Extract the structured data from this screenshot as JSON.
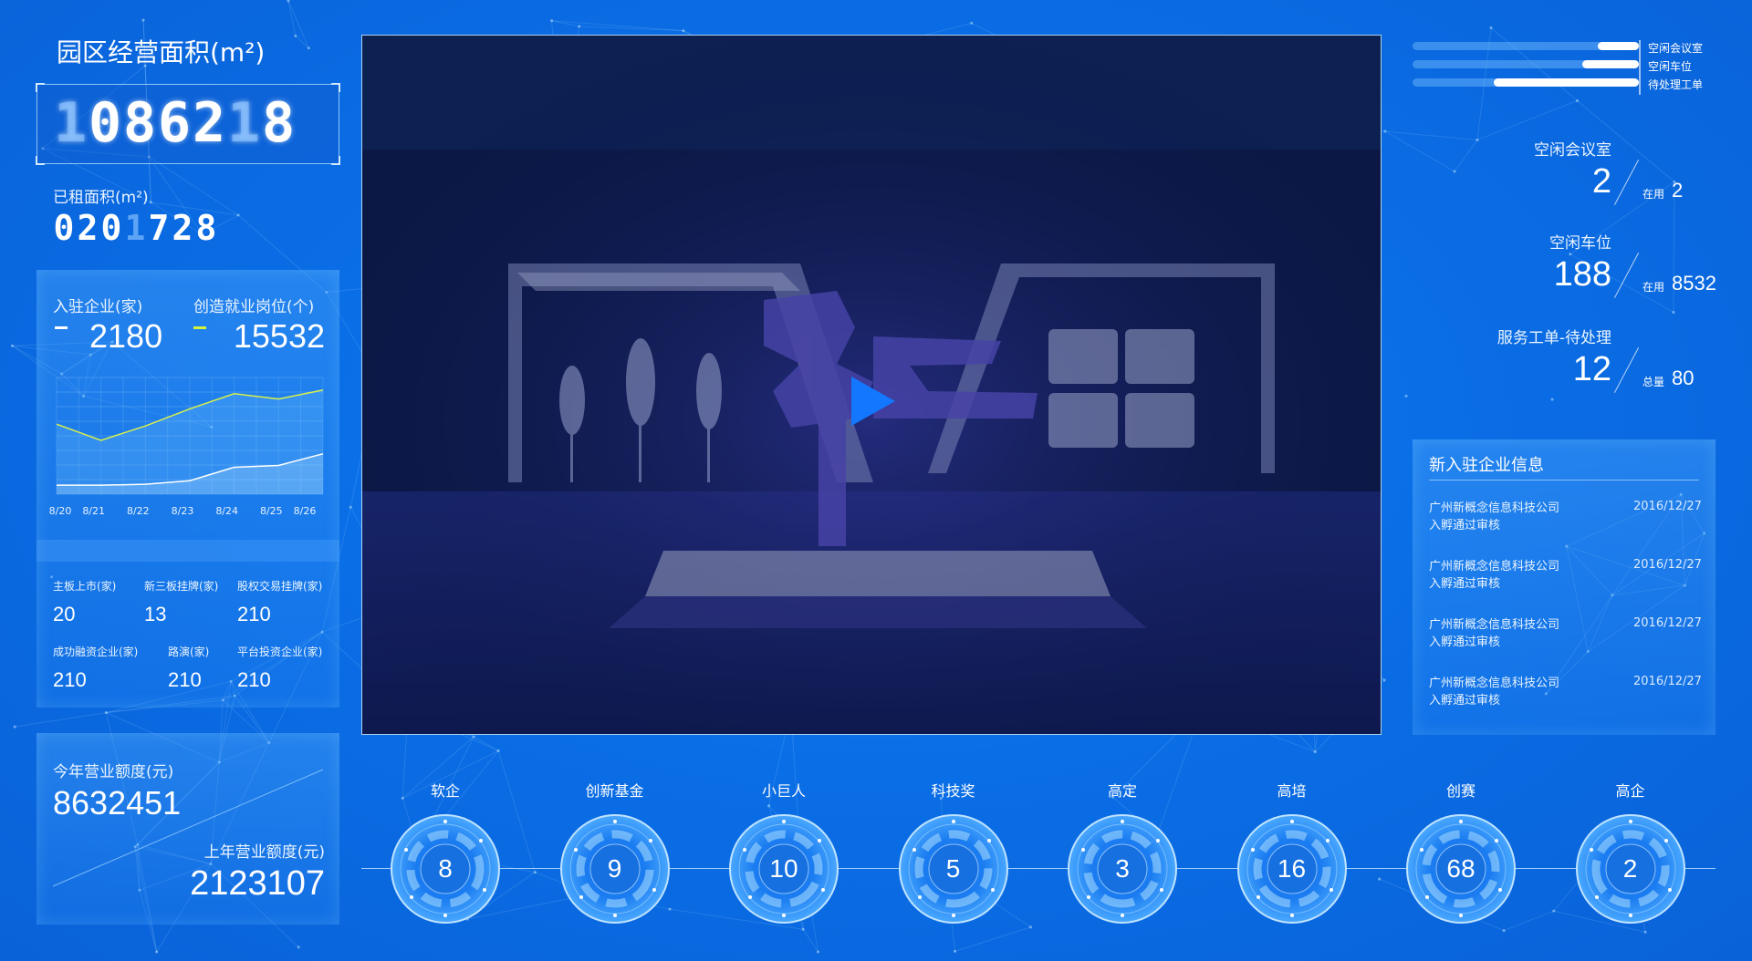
{
  "total_area": {
    "label": "园区经营面积(m²)",
    "digits": [
      "1",
      "0",
      "8",
      "6",
      "2",
      "1",
      "8"
    ],
    "dim_index": [
      0,
      5
    ]
  },
  "rented_area": {
    "label": "已租面积(m²)",
    "digits": [
      "0",
      "2",
      "0",
      "1",
      "7",
      "2",
      "8"
    ],
    "dim_index": [
      3
    ]
  },
  "enterprises": {
    "label": "入驻企业(家)",
    "value": "2180",
    "marker_color": "#ffffff"
  },
  "jobs": {
    "label": "创造就业岗位(个)",
    "value": "15532",
    "marker_color": "#d4f53c"
  },
  "trend_chart": {
    "type": "line",
    "x": [
      "8/20",
      "8/21",
      "8/22",
      "8/23",
      "8/24",
      "8/25",
      "8/26"
    ],
    "series": [
      {
        "values": [
          78,
          60,
          76,
          95,
          112,
          106,
          116
        ],
        "color": "#d9f04a"
      },
      {
        "values": [
          10,
          10,
          11,
          15,
          30,
          32,
          45
        ],
        "color": "#ffffff"
      }
    ],
    "ylim": [
      0,
      130
    ],
    "grid": true
  },
  "stats": [
    {
      "label": "主板上市(家)",
      "value": "20"
    },
    {
      "label": "新三板挂牌(家)",
      "value": "13"
    },
    {
      "label": "股权交易挂牌(家)",
      "value": "210"
    },
    {
      "label": "成功融资企业(家)",
      "value": "210"
    },
    {
      "label": "路演(家)",
      "value": "210"
    },
    {
      "label": "平台投资企业(家)",
      "value": "210"
    }
  ],
  "revenue": {
    "this_year_label": "今年营业额度(元)",
    "this_year_value": "8632451",
    "last_year_label": "上年营业额度(元)",
    "last_year_value": "2123107"
  },
  "video": {
    "play_icon": "play-icon",
    "accent": "#1477ff"
  },
  "usage_bars": [
    {
      "label": "空闲会议室",
      "fraction": 0.18
    },
    {
      "label": "空闲车位",
      "fraction": 0.25
    },
    {
      "label": "待处理工单",
      "fraction": 0.64
    }
  ],
  "resources": [
    {
      "title": "空闲会议室",
      "value": "2",
      "sub_label": "在用",
      "sub_value": "2"
    },
    {
      "title": "空闲车位",
      "value": "188",
      "sub_label": "在用",
      "sub_value": "8532"
    },
    {
      "title": "服务工单-待处理",
      "value": "12",
      "sub_label": "总量",
      "sub_value": "80"
    }
  ],
  "news": {
    "title": "新入驻企业信息",
    "items": [
      {
        "company": "广州新概念信息科技公司",
        "status": "入孵通过审核",
        "date": "2016/12/27"
      },
      {
        "company": "广州新概念信息科技公司",
        "status": "入孵通过审核",
        "date": "2016/12/27"
      },
      {
        "company": "广州新概念信息科技公司",
        "status": "入孵通过审核",
        "date": "2016/12/27"
      },
      {
        "company": "广州新概念信息科技公司",
        "status": "入孵通过审核",
        "date": "2016/12/27"
      }
    ]
  },
  "badges": [
    {
      "label": "软企",
      "value": "8"
    },
    {
      "label": "创新基金",
      "value": "9"
    },
    {
      "label": "小巨人",
      "value": "10"
    },
    {
      "label": "科技奖",
      "value": "5"
    },
    {
      "label": "高定",
      "value": "3"
    },
    {
      "label": "高培",
      "value": "16"
    },
    {
      "label": "创赛",
      "value": "68"
    },
    {
      "label": "高企",
      "value": "2"
    }
  ],
  "colors": {
    "background": "#0a6ee6",
    "panel": "#2f8cf5",
    "highlight": "#ffffff"
  }
}
